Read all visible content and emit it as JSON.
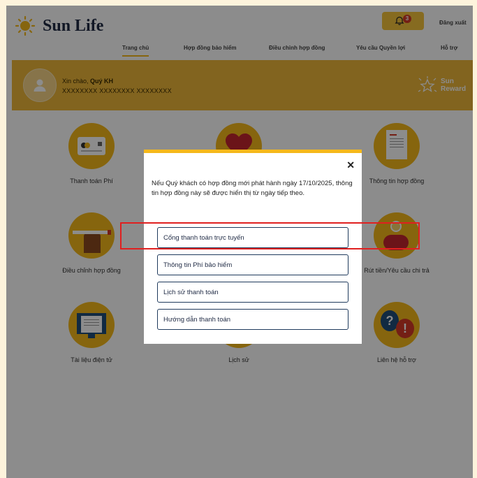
{
  "header": {
    "brand": "Sun Life",
    "notification_count": "3",
    "logout_label": "Đăng xuất"
  },
  "nav": {
    "items": [
      {
        "label": "Trang chủ"
      },
      {
        "label": "Hợp đồng bảo hiểm"
      },
      {
        "label": "Điều chỉnh hợp đồng"
      },
      {
        "label": "Yêu cầu Quyền lợi"
      },
      {
        "label": "Hỗ trợ"
      }
    ]
  },
  "banner": {
    "greeting_prefix": "Xin chào, ",
    "user_name": "Quý KH",
    "account_number": "XXXXXXXX XXXXXXXX XXXXXXXX",
    "reward_line1": "Sun",
    "reward_line2": "Reward"
  },
  "tiles": [
    {
      "label": "Thanh toán Phí"
    },
    {
      "label": ""
    },
    {
      "label": "Thông tin hợp đồng"
    },
    {
      "label": "Điều chỉnh hợp đồng"
    },
    {
      "label": "Rút tiền/Yêu cầu chi trả"
    },
    {
      "label": "Tài liệu điện tử"
    },
    {
      "label": "Lịch sử"
    },
    {
      "label": "Liên hệ hỗ trợ"
    }
  ],
  "modal": {
    "message": "Nếu Quý khách có hợp đồng mới phát hành ngày 17/10/2025, thông tin hợp đồng này sẽ được hiển thị từ ngày tiếp theo.",
    "close_symbol": "✕",
    "options": [
      {
        "label": "Cổng thanh toán trực tuyến"
      },
      {
        "label": "Thông tin Phí bảo hiểm"
      },
      {
        "label": "Lịch sử thanh toán"
      },
      {
        "label": "Hướng dẫn thanh toán"
      }
    ]
  },
  "colors": {
    "accent": "#f5b81b",
    "banner": "#edb739",
    "highlight": "#e02020"
  }
}
